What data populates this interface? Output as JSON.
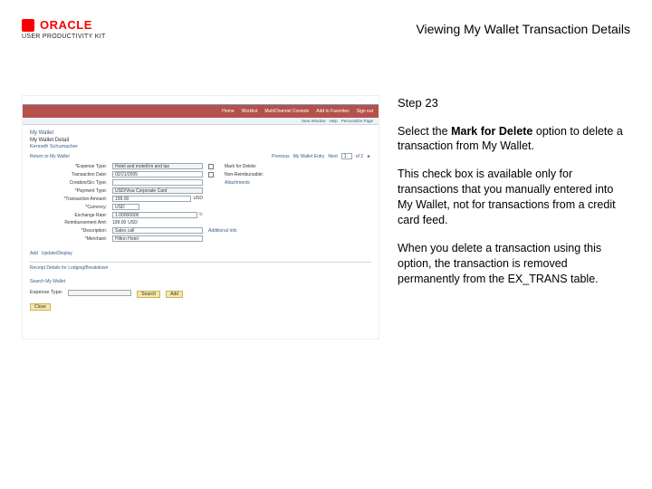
{
  "header": {
    "logo_word": "ORACLE",
    "logo_sub": "USER PRODUCTIVITY KIT",
    "title": "Viewing My Wallet Transaction Details"
  },
  "instruction": {
    "step_label": "Step 23",
    "p1_a": "Select the ",
    "p1_bold": "Mark for Delete",
    "p1_b": " option to delete a transaction from My Wallet.",
    "p2": "This check box is available only for transactions that you manually entered into My Wallet, not for transactions from a credit card feed.",
    "p3": "When you delete a transaction using this option, the transaction is removed permanently from the EX_TRANS table."
  },
  "screenshot": {
    "nav": {
      "i1": "Home",
      "i2": "Worklist",
      "i3": "MultiChannel Console",
      "i4": "Add to Favorites",
      "i5": "Sign out"
    },
    "sub": {
      "a": "New Window",
      "b": "Help",
      "c": "Personalize Page"
    },
    "breadcrumb": "My Wallet",
    "page_title": "My Wallet Detail",
    "emp": "Kenneth Schumacher",
    "toolbar": {
      "ret": "Return to My Wallet",
      "prev": "Previous",
      "tab": "My Wallet Entry",
      "next": "Next",
      "eti": "1",
      "of": "of 2",
      "arrow": "►"
    },
    "form": {
      "expense_type_l": "*Expense Type:",
      "expense_type": "Hotel and motel/rm and tax",
      "trans_date_l": "Transaction Date:",
      "trans_date": "02/21/2005",
      "created_l": "Creation/Src Type:",
      "payment_l": "*Payment Type:",
      "payment": "USD/Visa Corporate Card",
      "amount_l": "*Transaction Amount:",
      "amount": "199.00",
      "cur": "USD",
      "currency_l": "*Currency:",
      "currency": "USD",
      "rate_l": "Exchange Rate:",
      "rate": "1.00000000",
      "rbtn": "↻",
      "reimb_l": "Reimbursement Amt:",
      "reimb": "199.00",
      "reimb_cur": "USD",
      "mark_l": "Mark for Delete:",
      "mark_cb": "",
      "nonreimb_l": "Non-Reimbursable:",
      "attach_l": "Attachments",
      "desc_l": "*Description:",
      "desc": "Sales call",
      "merch_l": "*Merchant:",
      "merch": "Hilton Hotel",
      "addinfo": "Additional Info"
    },
    "row2": {
      "a": "Add",
      "b": "Update/Display"
    },
    "sec1": "Receipt Details for Lodging/Breakdown",
    "sec2": "Search My Wallet",
    "srch_type_l": "Expense Type:",
    "srch_btn": "Search",
    "add_btn": "Add",
    "close": "Close"
  }
}
